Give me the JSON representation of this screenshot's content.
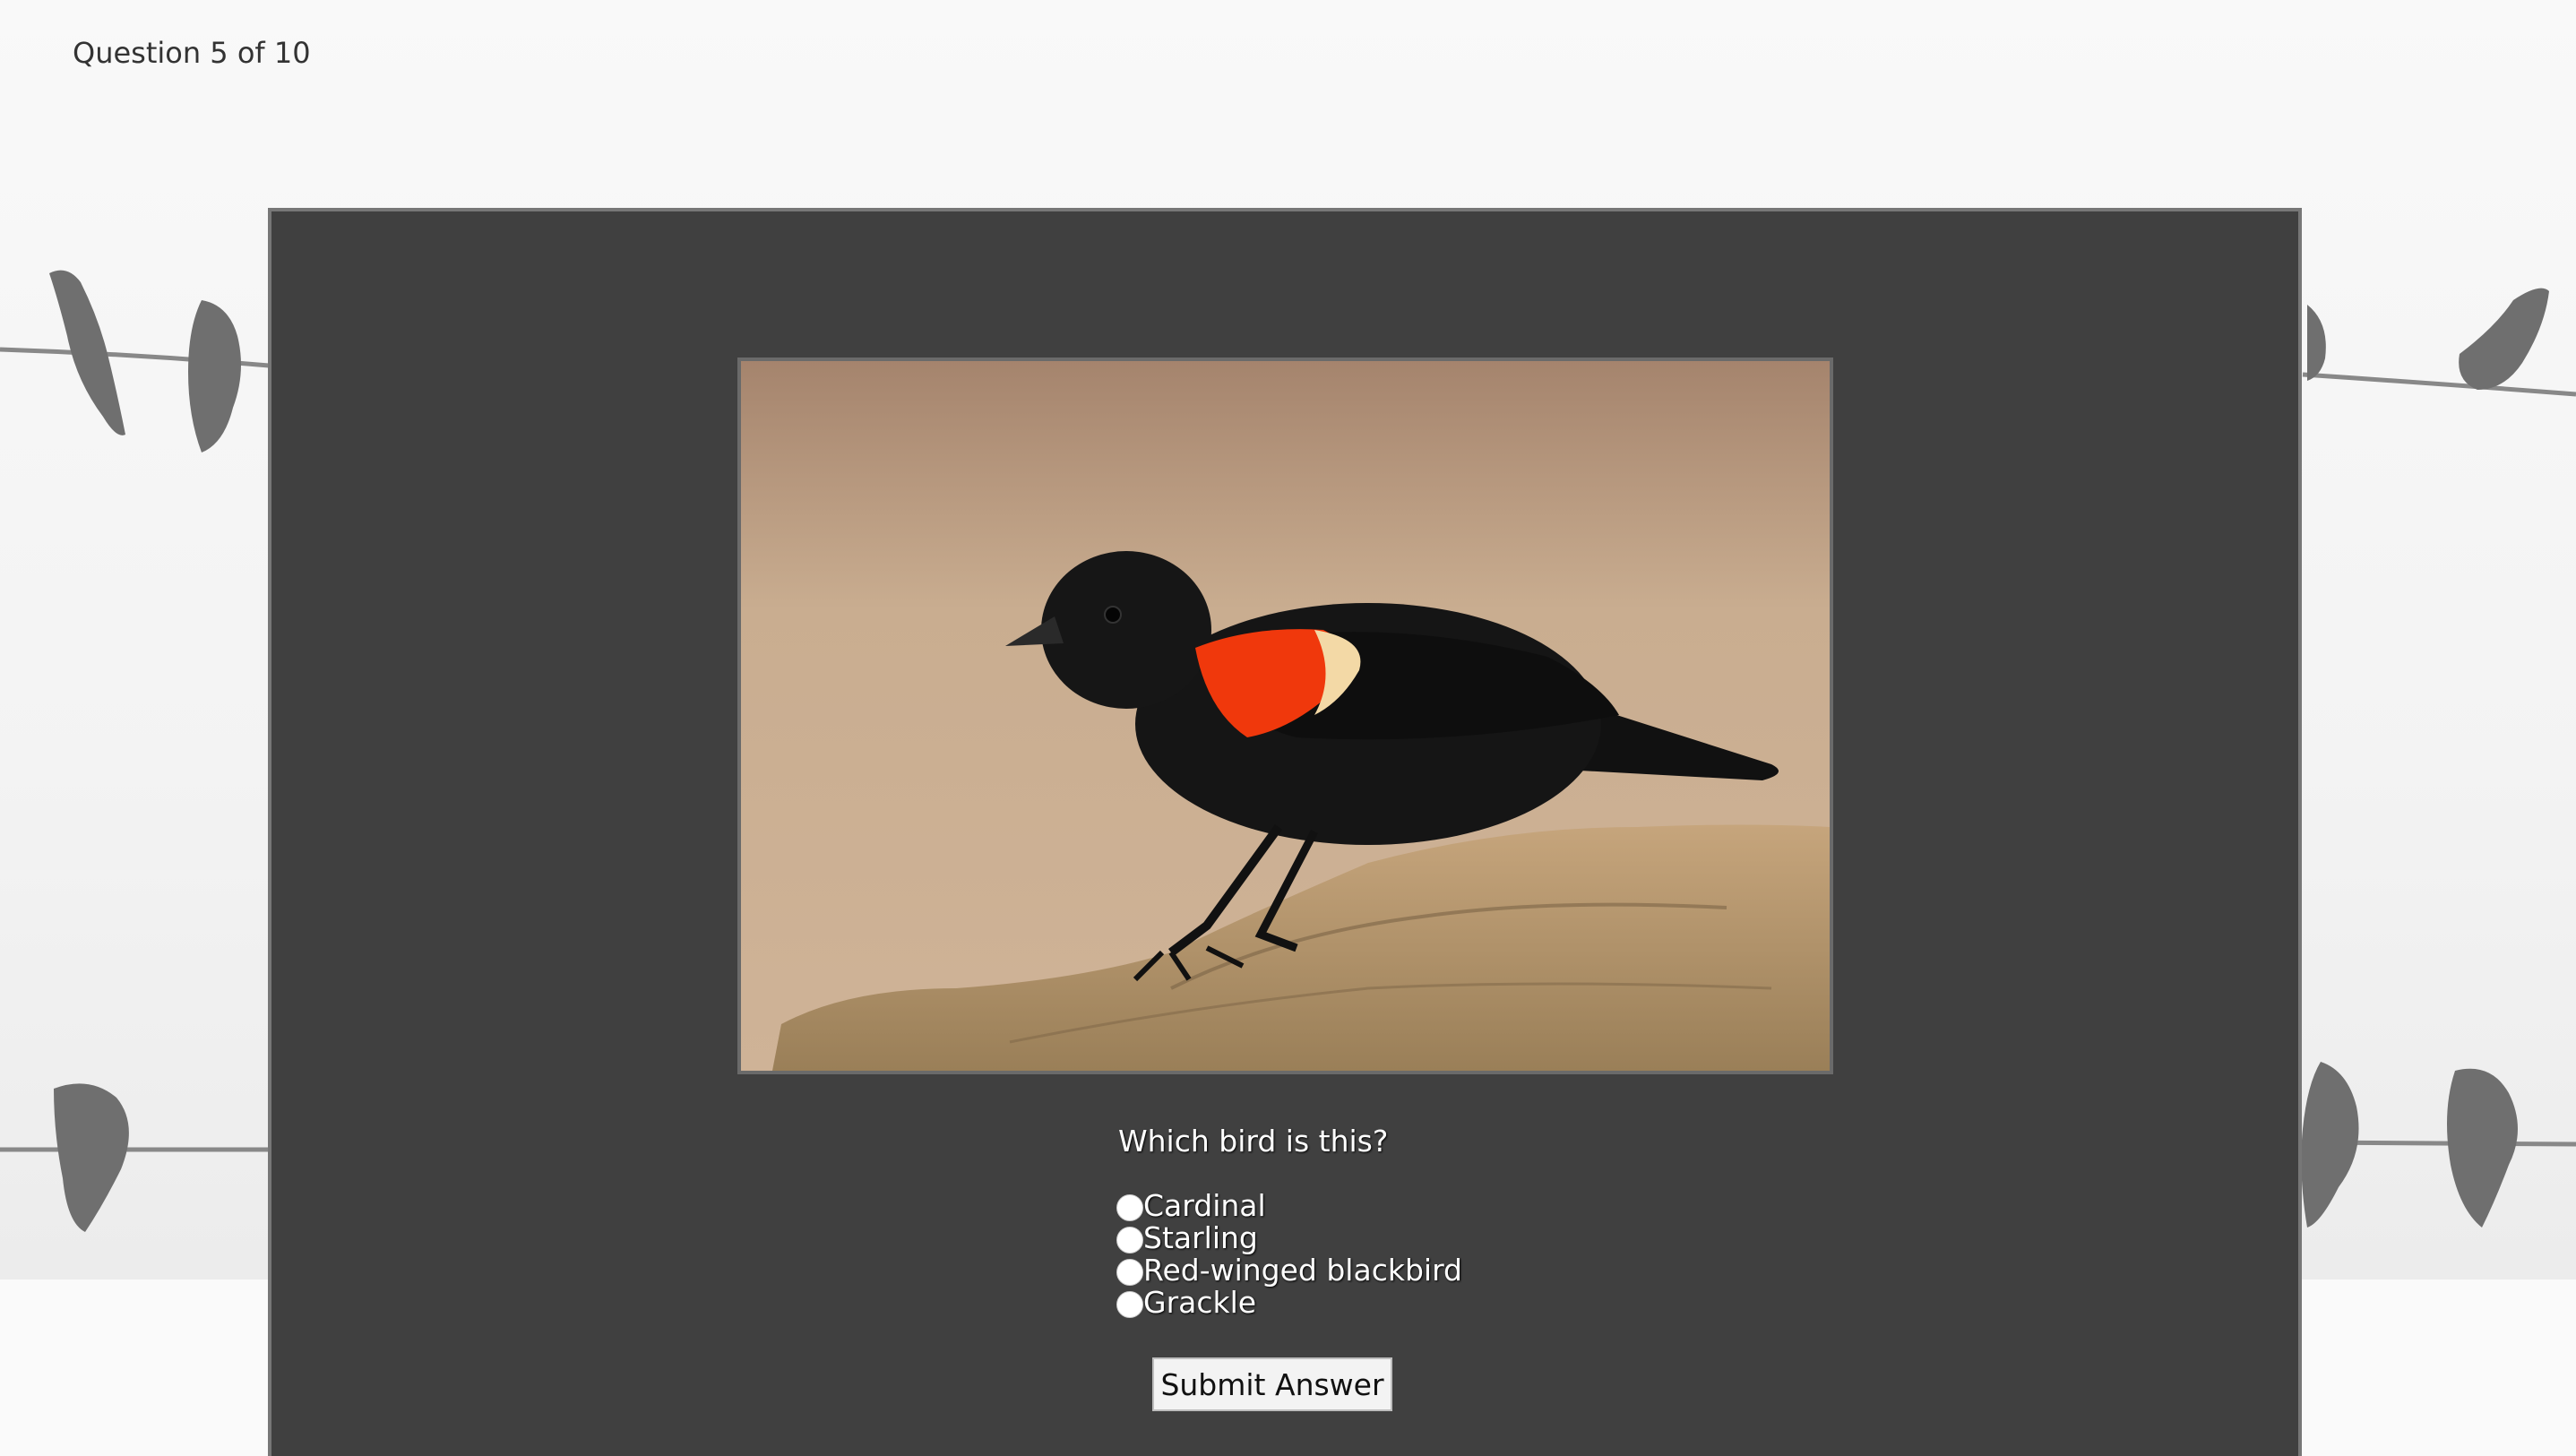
{
  "quiz": {
    "progress_text": "Question 5 of 10",
    "question": "Which bird is this?",
    "options": [
      {
        "label": "Cardinal"
      },
      {
        "label": "Starling"
      },
      {
        "label": "Red-winged blackbird"
      },
      {
        "label": "Grackle"
      }
    ],
    "submit_label": "Submit Answer"
  },
  "colors": {
    "panel": "#404040",
    "background": "#f7f7f7",
    "text_on_panel": "#ffffff"
  }
}
